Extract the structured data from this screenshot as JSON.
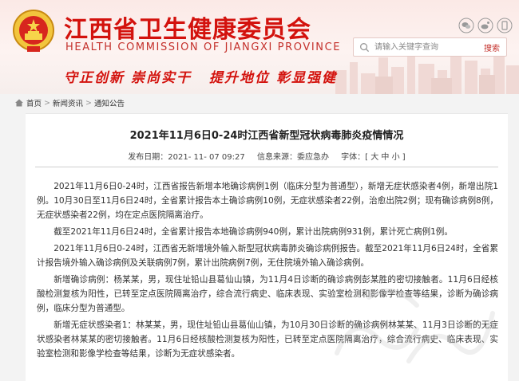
{
  "header": {
    "title_cn": "江西省卫生健康委员会",
    "title_en": "HEALTH COMMISSION OF JIANGXI PROVINCE",
    "slogans": [
      "守正创新",
      "崇尚实干",
      "提升地位",
      "彰显强健"
    ],
    "social_icons": [
      "wechat-icon",
      "weibo-icon",
      "app-icon"
    ],
    "search": {
      "placeholder": "请输入关键字查询",
      "button_label": "搜索"
    },
    "brand_color": "#d3120d"
  },
  "breadcrumb": {
    "items": [
      "首页",
      "新闻资讯",
      "通知公告"
    ],
    "separator": ">"
  },
  "article": {
    "title": "2021年11月6日0-24时江西省新型冠状病毒肺炎疫情情况",
    "published_label": "发布日期：",
    "published_value": "2021- 11- 07 09:27",
    "source_label": "信息来源：",
    "source_value": "委应急办",
    "font_size_label": "字体：[",
    "font_size_options": [
      "大",
      "中",
      "小"
    ],
    "font_size_close": "]",
    "paragraphs": [
      "2021年11月6日0-24时，江西省报告新增本地确诊病例1例（临床分型为普通型），新增无症状感染者4例，新增出院1例。10月30日至11月6日24时，全省累计报告本土确诊病例10例，无症状感染者22例，治愈出院2例；现有确诊病例8例，无症状感染者22例，均在定点医院隔离治疗。",
      "截至2021年11月6日24时，全省累计报告本地确诊病例940例，累计出院病例931例，累计死亡病例1例。",
      "2021年11月6日0-24时，江西省无新增境外输入新型冠状病毒肺炎确诊病例报告。截至2021年11月6日24时，全省累计报告境外输入确诊病例及关联病例7例，累计出院病例7例，无住院境外输入确诊病例。",
      "新增确诊病例：杨某某，男，现住址铅山县葛仙山镇，为11月4日诊断的确诊病例彭某胜的密切接触者。11月6日经核酸检测复核为阳性，已转至定点医院隔离治疗，综合流行病史、临床表现、实验室检测和影像学检查等结果，诊断为确诊病例，临床分型为普通型。",
      "新增无症状感染者1：林某某，男，现住址铅山县葛仙山镇，为10月30日诊断的确诊病例林某某、11月3日诊断的无症状感染者林某某的密切接触者。11月6日经核酸检测复核为阳性，已转至定点医院隔离治疗，综合流行病史、临床表现、实验室检测和影像学检查等结果，诊断为无症状感染者。"
    ]
  }
}
